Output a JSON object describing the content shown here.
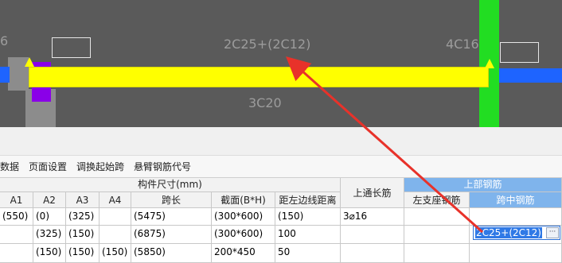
{
  "viewport": {
    "left_fragment": "6",
    "top_label": "2C25+(2C12)",
    "right_label": "4C16",
    "bottom_label": "3C20",
    "colors": {
      "background": "#5a5a5a",
      "beam": "#ffff00",
      "column": "#22dd22",
      "support": "#8a00e8",
      "bar": "#1e64ff",
      "annotation_arrow": "#e8322a"
    }
  },
  "toolbar": {
    "items": [
      "数据",
      "页面设置",
      "调换起始跨",
      "悬臂钢筋代号"
    ]
  },
  "table": {
    "group_header": "构件尺寸(mm)",
    "columns": [
      "A1",
      "A2",
      "A3",
      "A4",
      "跨长",
      "截面(B*H)",
      "距左边线距离"
    ],
    "top_through_bar": "上通长筋",
    "top_rebar": "上部钢筋",
    "left_support_rebar": "左支座钢筋",
    "mid_span_rebar": "跨中钢筋",
    "rows": [
      [
        "(550)",
        "(0)",
        "(325)",
        "",
        "(5475)",
        "(300*600)",
        "(150)",
        "3⌀16",
        "",
        ""
      ],
      [
        "",
        "(325)",
        "(150)",
        "",
        "(6875)",
        "(300*600)",
        "100",
        "",
        "",
        "2C25+(2C12)"
      ],
      [
        "",
        "(150)",
        "(150)",
        "(150)",
        "(5850)",
        "200*450",
        "50",
        "",
        "",
        ""
      ]
    ],
    "edit_dots": "···"
  }
}
